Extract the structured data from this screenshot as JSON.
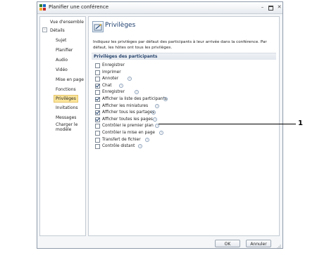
{
  "window": {
    "title": "Planifier une conférence",
    "controls": {
      "minimize": "–",
      "close": "✕"
    }
  },
  "sidebar": {
    "toggle": "–",
    "items": [
      {
        "label": "Vue d'ensemble"
      },
      {
        "label": "Détails"
      },
      {
        "label": "Sujet"
      },
      {
        "label": "Planifier"
      },
      {
        "label": "Audio"
      },
      {
        "label": "Vidéo"
      },
      {
        "label": "Mise en page"
      },
      {
        "label": "Fonctions"
      },
      {
        "label": "Privilèges",
        "selected": true
      },
      {
        "label": "Invitations"
      },
      {
        "label": "Messages"
      },
      {
        "label": "Charger le\nmodèle"
      }
    ]
  },
  "content": {
    "title": "Privilèges",
    "description": "Indiquez les privilèges par défaut des participants à leur arrivée dans la conférence.  Par défaut, les hôtes ont tous les privilèges.",
    "section_title": "Privilèges des participants",
    "info_glyph": "i",
    "permissions": [
      {
        "label": "Enregistrer",
        "checked": false,
        "info": false
      },
      {
        "label": "Imprimer",
        "checked": false,
        "info": false
      },
      {
        "label": "Annoter",
        "checked": false,
        "info": true
      },
      {
        "label": "Chat",
        "checked": true,
        "info": true
      },
      {
        "label": "Enregistrer",
        "checked": false,
        "info": true
      },
      {
        "label": "Afficher la liste des participants",
        "checked": true,
        "info": true
      },
      {
        "label": "Afficher les miniatures",
        "checked": false,
        "info": true
      },
      {
        "label": "Afficher tous les partages",
        "checked": true,
        "info": true
      },
      {
        "label": "Afficher toutes les pages",
        "checked": true,
        "info": true
      },
      {
        "label": "Contrôler le premier plan",
        "checked": false,
        "info": true
      },
      {
        "label": "Contrôler la mise en page",
        "checked": false,
        "info": true
      },
      {
        "label": "Transfert de fichier",
        "checked": false,
        "info": true
      },
      {
        "label": "Contrôle distant",
        "checked": false,
        "info": true
      }
    ]
  },
  "footer": {
    "ok_label": "OK",
    "cancel_label": "Annuler"
  },
  "callout": {
    "number": "1"
  },
  "colors": {
    "accent": "#1d3e6e",
    "selection": "#fbe59b",
    "check": "#1c3f6b"
  }
}
